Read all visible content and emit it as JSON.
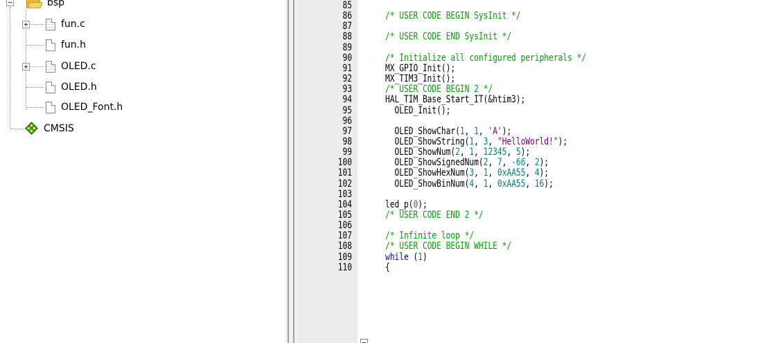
{
  "project_tree": {
    "folder": {
      "label": "bsp",
      "icon": "open-folder-icon"
    },
    "files": [
      {
        "label": "fun.c",
        "icon": "source-file-icon",
        "expandable": true
      },
      {
        "label": "fun.h",
        "icon": "header-file-icon",
        "expandable": false
      },
      {
        "label": "OLED.c",
        "icon": "source-file-icon",
        "expandable": true
      },
      {
        "label": "OLED.h",
        "icon": "header-file-icon",
        "expandable": false
      },
      {
        "label": "OLED_Font.h",
        "icon": "header-file-icon",
        "expandable": false
      }
    ],
    "component": {
      "label": "CMSIS",
      "icon": "cmsis-component-icon"
    }
  },
  "editor": {
    "colors": {
      "comment": "#00a000",
      "keyword": "#0000ff",
      "number": "#008080",
      "string": "#800080",
      "gutter_bg": "#ececec"
    },
    "lines": [
      {
        "num": "85",
        "tokens": []
      },
      {
        "num": "86",
        "tokens": [
          {
            "t": "/* USER CODE BEGIN SysInit */",
            "k": "comment"
          }
        ]
      },
      {
        "num": "87",
        "tokens": []
      },
      {
        "num": "88",
        "tokens": [
          {
            "t": "/* USER CODE END SysInit */",
            "k": "comment"
          }
        ]
      },
      {
        "num": "89",
        "tokens": []
      },
      {
        "num": "90",
        "tokens": [
          {
            "t": "/* Initialize all configured peripherals */",
            "k": "comment"
          }
        ]
      },
      {
        "num": "91",
        "tokens": [
          {
            "t": "MX_GPIO_Init();",
            "k": "plain"
          }
        ]
      },
      {
        "num": "92",
        "tokens": [
          {
            "t": "MX_TIM3_Init();",
            "k": "plain"
          }
        ]
      },
      {
        "num": "93",
        "tokens": [
          {
            "t": "/* USER CODE BEGIN 2 */",
            "k": "comment"
          }
        ]
      },
      {
        "num": "94",
        "tokens": [
          {
            "t": "HAL_TIM_Base_Start_IT(&htim3);",
            "k": "plain"
          }
        ]
      },
      {
        "num": "95",
        "tokens": [
          {
            "t": "  OLED_Init();",
            "k": "plain"
          }
        ]
      },
      {
        "num": "96",
        "tokens": []
      },
      {
        "num": "97",
        "tokens": [
          {
            "t": "  OLED_ShowChar(",
            "k": "plain"
          },
          {
            "t": "1",
            "k": "number"
          },
          {
            "t": ", ",
            "k": "plain"
          },
          {
            "t": "1",
            "k": "number"
          },
          {
            "t": ", ",
            "k": "plain"
          },
          {
            "t": "'A'",
            "k": "string"
          },
          {
            "t": ");",
            "k": "plain"
          }
        ]
      },
      {
        "num": "98",
        "tokens": [
          {
            "t": "  OLED_ShowString(",
            "k": "plain"
          },
          {
            "t": "1",
            "k": "number"
          },
          {
            "t": ", ",
            "k": "plain"
          },
          {
            "t": "3",
            "k": "number"
          },
          {
            "t": ", ",
            "k": "plain"
          },
          {
            "t": "\"HelloWorld!\"",
            "k": "string"
          },
          {
            "t": ");",
            "k": "plain"
          }
        ]
      },
      {
        "num": "99",
        "tokens": [
          {
            "t": "  OLED_ShowNum(",
            "k": "plain"
          },
          {
            "t": "2",
            "k": "number"
          },
          {
            "t": ", ",
            "k": "plain"
          },
          {
            "t": "1",
            "k": "number"
          },
          {
            "t": ", ",
            "k": "plain"
          },
          {
            "t": "12345",
            "k": "number"
          },
          {
            "t": ", ",
            "k": "plain"
          },
          {
            "t": "5",
            "k": "number"
          },
          {
            "t": ");",
            "k": "plain"
          }
        ]
      },
      {
        "num": "100",
        "tokens": [
          {
            "t": "  OLED_ShowSignedNum(",
            "k": "plain"
          },
          {
            "t": "2",
            "k": "number"
          },
          {
            "t": ", ",
            "k": "plain"
          },
          {
            "t": "7",
            "k": "number"
          },
          {
            "t": ", ",
            "k": "plain"
          },
          {
            "t": "-66",
            "k": "number"
          },
          {
            "t": ", ",
            "k": "plain"
          },
          {
            "t": "2",
            "k": "number"
          },
          {
            "t": ");",
            "k": "plain"
          }
        ]
      },
      {
        "num": "101",
        "tokens": [
          {
            "t": "  OLED_ShowHexNum(",
            "k": "plain"
          },
          {
            "t": "3",
            "k": "number"
          },
          {
            "t": ", ",
            "k": "plain"
          },
          {
            "t": "1",
            "k": "number"
          },
          {
            "t": ", ",
            "k": "plain"
          },
          {
            "t": "0xAA55",
            "k": "number"
          },
          {
            "t": ", ",
            "k": "plain"
          },
          {
            "t": "4",
            "k": "number"
          },
          {
            "t": ");",
            "k": "plain"
          }
        ]
      },
      {
        "num": "102",
        "tokens": [
          {
            "t": "  OLED_ShowBinNum(",
            "k": "plain"
          },
          {
            "t": "4",
            "k": "number"
          },
          {
            "t": ", ",
            "k": "plain"
          },
          {
            "t": "1",
            "k": "number"
          },
          {
            "t": ", ",
            "k": "plain"
          },
          {
            "t": "0xAA55",
            "k": "number"
          },
          {
            "t": ", ",
            "k": "plain"
          },
          {
            "t": "16",
            "k": "number"
          },
          {
            "t": ");",
            "k": "plain"
          }
        ]
      },
      {
        "num": "103",
        "tokens": []
      },
      {
        "num": "104",
        "tokens": [
          {
            "t": "led_p(",
            "k": "plain"
          },
          {
            "t": "0",
            "k": "number"
          },
          {
            "t": ");",
            "k": "plain"
          }
        ]
      },
      {
        "num": "105",
        "tokens": [
          {
            "t": "/* USER CODE END 2 */",
            "k": "comment"
          }
        ]
      },
      {
        "num": "106",
        "tokens": []
      },
      {
        "num": "107",
        "tokens": [
          {
            "t": "/* Infinite loop */",
            "k": "comment"
          }
        ]
      },
      {
        "num": "108",
        "tokens": [
          {
            "t": "/* USER CODE BEGIN WHILE */",
            "k": "comment"
          }
        ]
      },
      {
        "num": "109",
        "tokens": [
          {
            "t": "while",
            "k": "keyword"
          },
          {
            "t": " (",
            "k": "plain"
          },
          {
            "t": "1",
            "k": "number"
          },
          {
            "t": ")",
            "k": "plain"
          }
        ]
      },
      {
        "num": "110",
        "tokens": [
          {
            "t": "{",
            "k": "plain"
          }
        ]
      }
    ]
  }
}
